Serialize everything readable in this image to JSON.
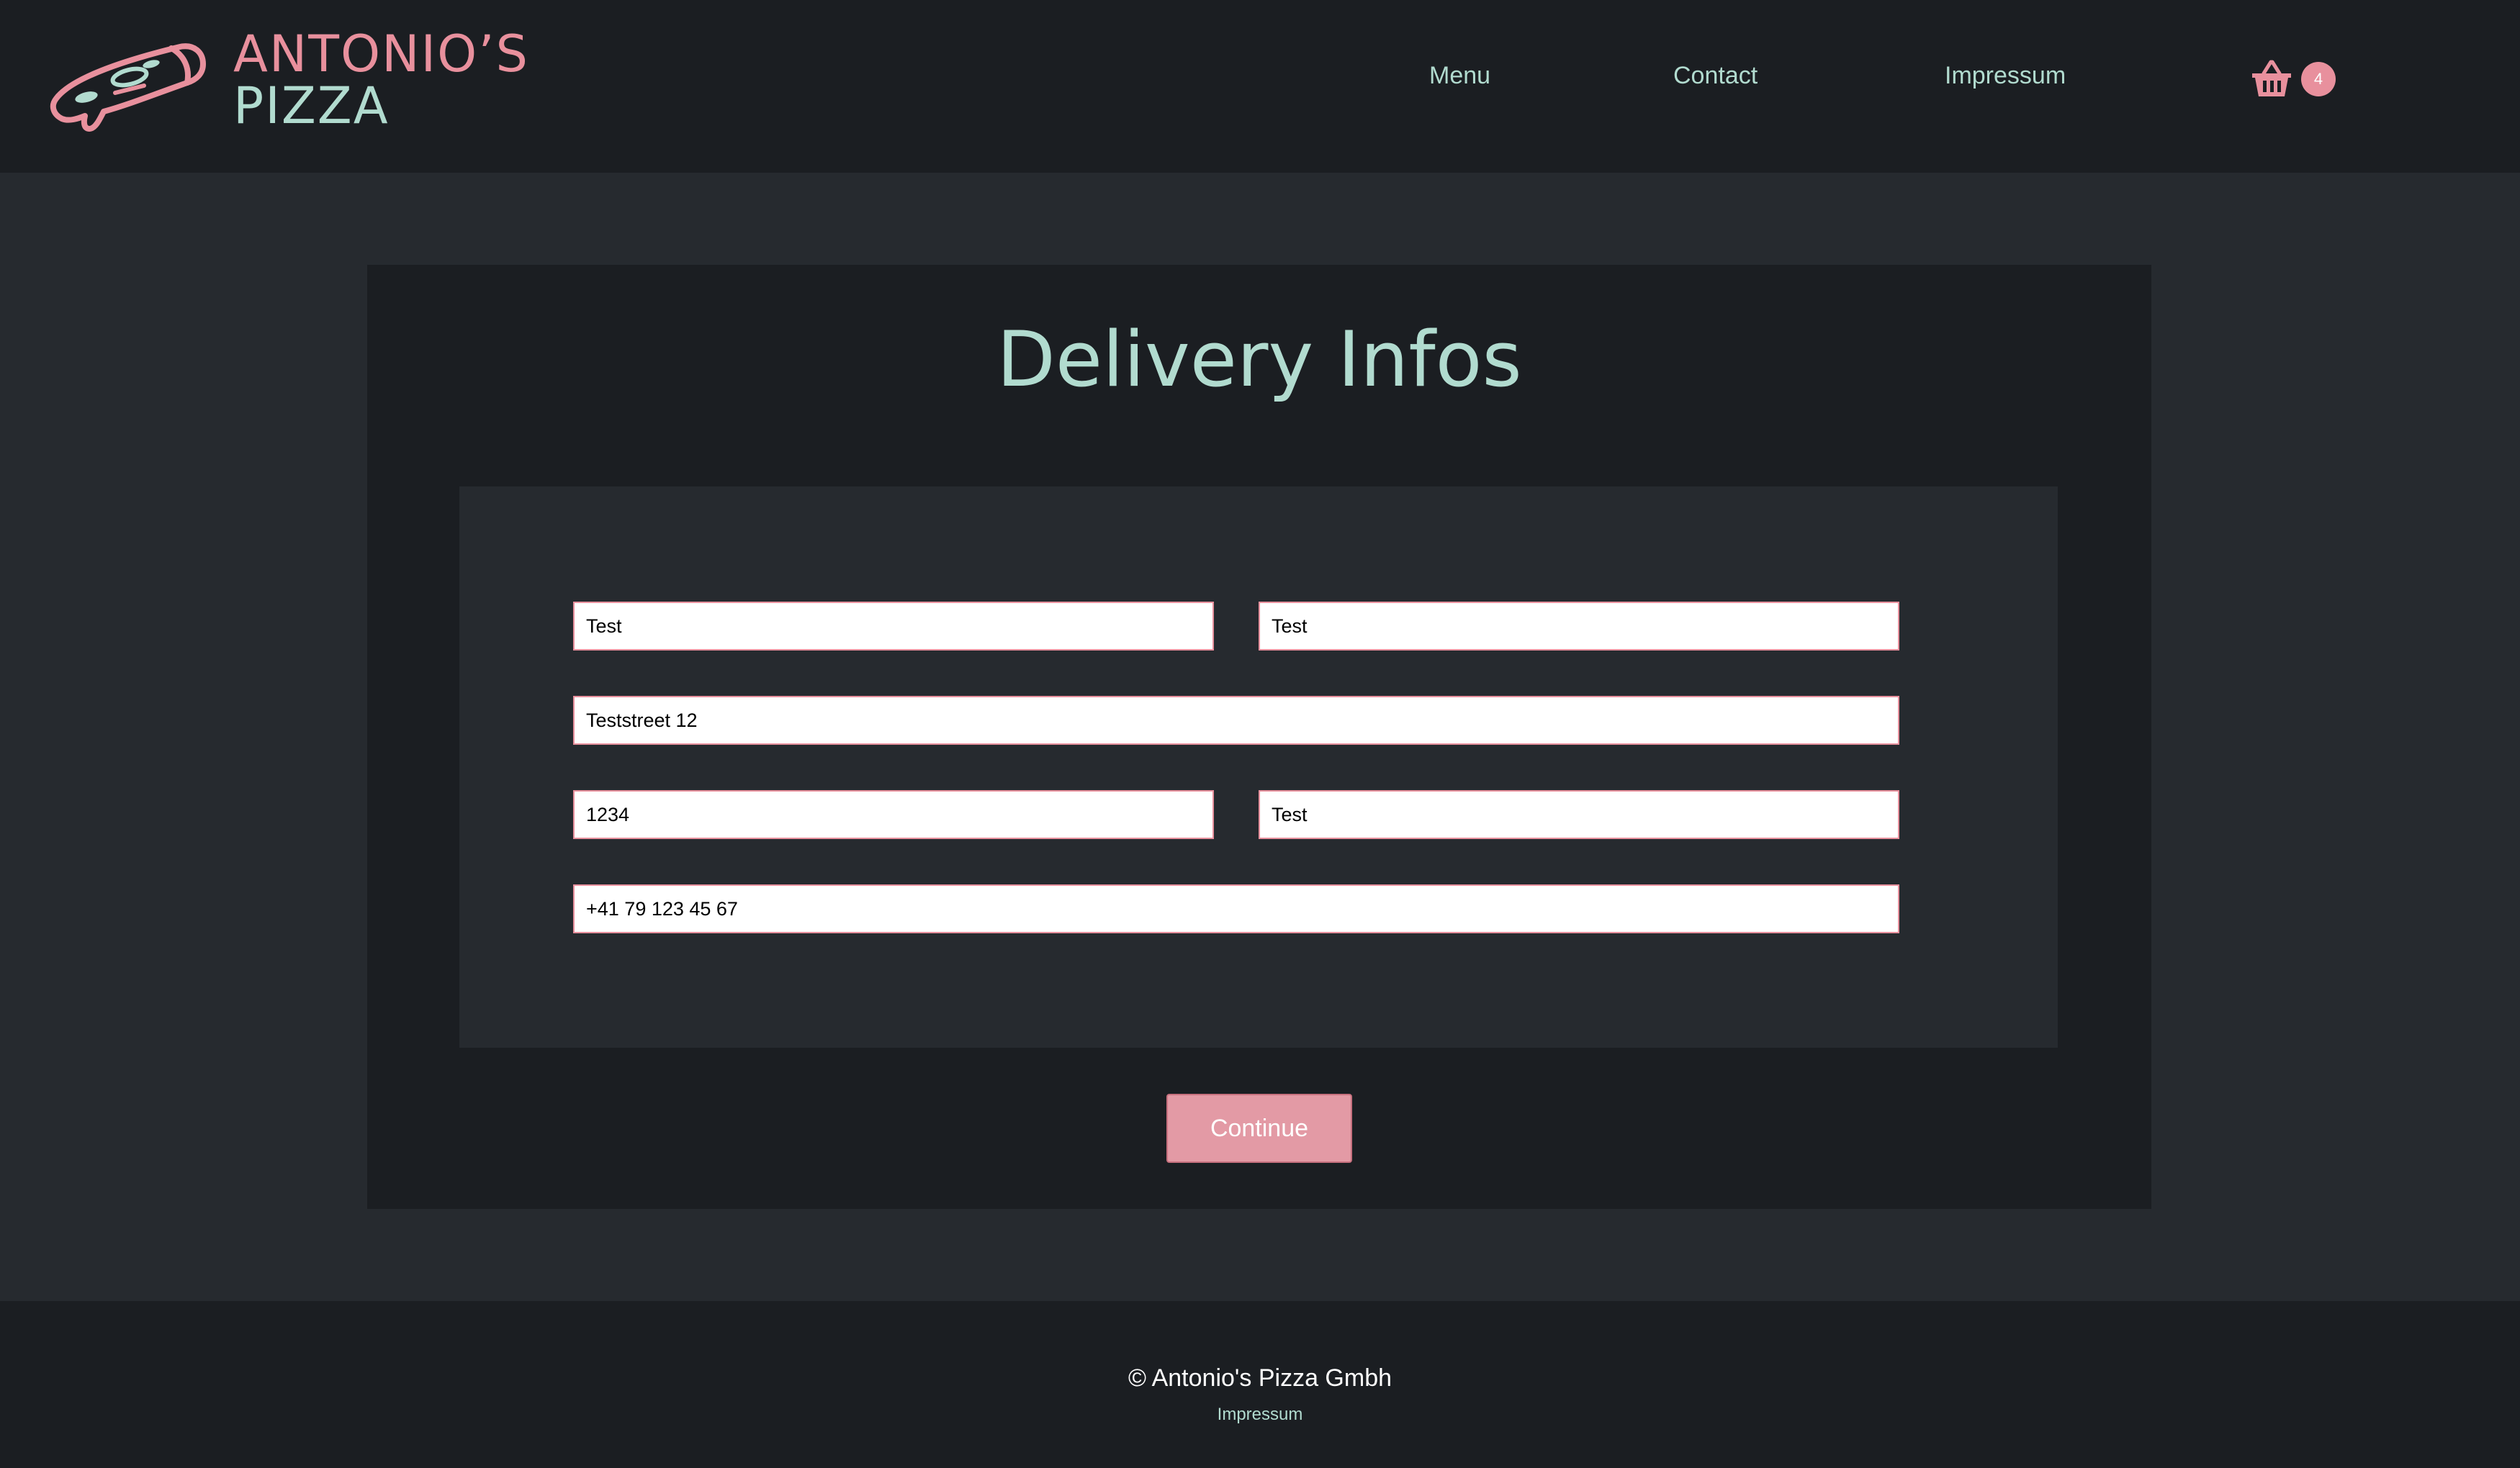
{
  "brand": {
    "name_top": "ANTONIO’S",
    "name_bottom": "PIZZA",
    "logo_icon": "pizza-slice-icon"
  },
  "nav": {
    "items": [
      {
        "label": "Menu"
      },
      {
        "label": "Contact"
      },
      {
        "label": "Impressum"
      }
    ],
    "cart": {
      "icon": "basket-icon",
      "count": "4"
    }
  },
  "page": {
    "title": "Delivery Infos"
  },
  "form": {
    "first_name": "Test",
    "last_name": "Test",
    "street": "Teststreet 12",
    "zip": "1234",
    "city": "Test",
    "phone": "+41 79 123 45 67",
    "continue_label": "Continue"
  },
  "footer": {
    "copyright": "© Antonio's Pizza Gmbh",
    "link": "Impressum"
  },
  "colors": {
    "background": "#262a2f",
    "surface": "#1b1e22",
    "accent_pink": "#e8909d",
    "accent_mint": "#b1dbcf",
    "button": "#e39aa5"
  }
}
